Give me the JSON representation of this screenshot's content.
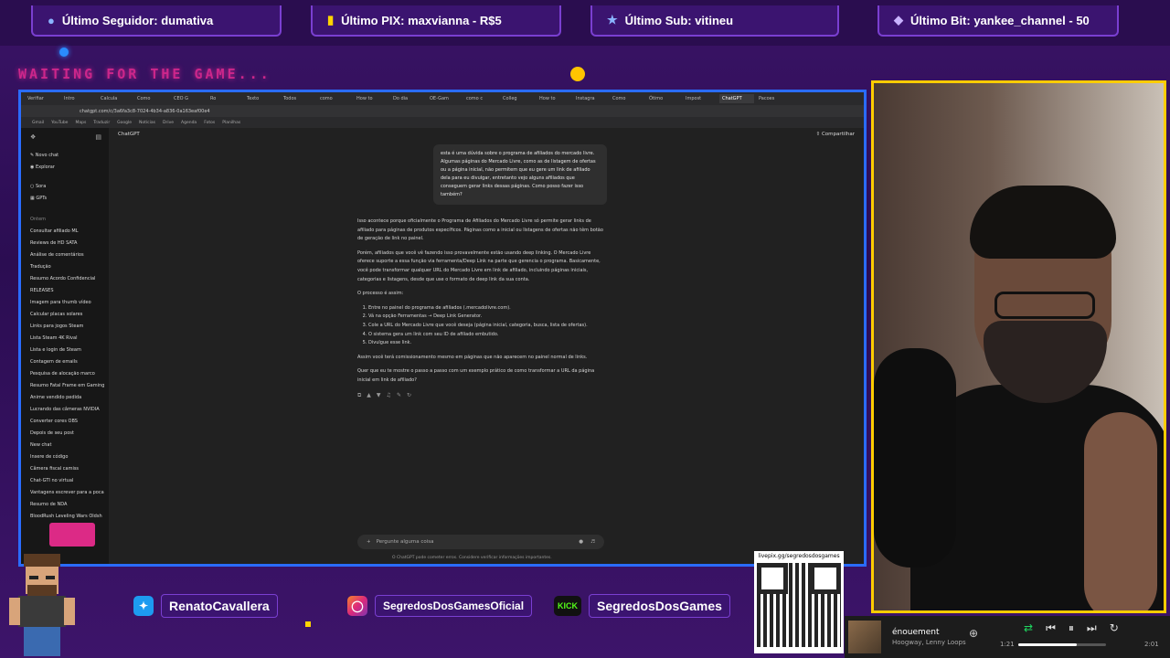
{
  "overlay": {
    "top_boxes": [
      {
        "icon": "user-icon",
        "label": "Último Seguidor: dumativa"
      },
      {
        "icon": "pix-icon",
        "label": "Último PIX: maxvianna - R$5"
      },
      {
        "icon": "star-icon",
        "label": "Último Sub: vitineu"
      },
      {
        "icon": "bits-icon",
        "label": "Último Bit: yankee_channel - 50"
      }
    ],
    "waiting_text": "WAITING FOR THE GAME...",
    "socials": [
      {
        "icon": "twitter-icon",
        "label": "RenatoCavallera"
      },
      {
        "icon": "instagram-icon",
        "label": "SegredosDosGamesOficial"
      },
      {
        "icon": "kick-icon",
        "badge": "KICK",
        "label": "SegredosDosGames"
      }
    ],
    "qr_label": "livepix.gg/segredosdosgames",
    "colors": {
      "accent": "#7a3fd1",
      "cam_border": "#ffcc00",
      "browser_border": "#2a6cff",
      "neon_pink": "#ff2e9a"
    }
  },
  "browser": {
    "tabs": [
      "Verifiar",
      "Intro",
      "Calcula",
      "Como",
      "CEO G",
      "Ro",
      "Texto",
      "Todos",
      "como",
      "How to",
      "Do dia",
      "OE-Gam",
      "como c",
      "Colleg",
      "How to",
      "Instagra",
      "Como",
      "Ótimo",
      "Impost",
      "ChatGPT",
      "Pacoes"
    ],
    "active_tab_index": 19,
    "url": "chatgpt.com/c/3a6fa3c8-7024-4b34-a836-0a163eaf00e4",
    "bookmarks": [
      "Gmail",
      "YouTube",
      "Maps",
      "Traduzir",
      "Google",
      "Notícias",
      "Drive",
      "Agenda",
      "Fotos",
      "Planilhas"
    ]
  },
  "chatgpt": {
    "sidebar": {
      "new_chat": "Novo chat",
      "explore": "Explorar",
      "sora": "Sora",
      "gpts": "GPTs",
      "section_today": "Ontem",
      "items": [
        "Consultar afiliado ML",
        "Reviews de HD SATA",
        "Análise de comentários",
        "Tradução",
        "Resumo Acordo Confidencial",
        "RELEASES",
        "Imagem para thumb vídeo",
        "Calcular placas solares",
        "Links para jogos Steam",
        "Lista Steam 4K Rival",
        "Lista e login de Steam",
        "Contagem de emails",
        "Pesquisa de alocação marco",
        "Resumo Fatal Frame em Gaming",
        "Anime vendido pedida",
        "Lucrando das câmeras NVIDIA",
        "Converter cores OBS",
        "Depois de seu post",
        "New chat",
        "Insere de código",
        "Câmera fiscal camiss",
        "Chat-GTI no virtual",
        "Vantagens escrever para a poca",
        "Resumo de NDA",
        "BloodRush Leveling Wars Oldsh"
      ]
    },
    "model_label": "ChatGPT",
    "share_label": "Compartilhar",
    "user_message": "esta é uma dúvida sobre o programa de afiliados do mercado livre. Algumas páginas do Mercado Livre, como as de listagem de ofertas ou a página inicial, não permitem que eu gere um link de afiliado dela para eu divulgar, entretanto vejo alguns afiliados que conseguem gerar links dessas páginas. Como posso fazer isso também?",
    "answer": {
      "p1": "Isso acontece porque oficialmente o Programa de Afiliados do Mercado Livre só permite gerar links de afiliado para páginas de produtos específicos. Páginas como a inicial ou listagens de ofertas não têm botão de geração de link no painel.",
      "p2": "Porém, afiliados que você vê fazendo isso provavelmente estão usando deep linking. O Mercado Livre oferece suporte a essa função via ferramenta/Deep Link na parte que gerencia o programa. Basicamente, você pode transformar qualquer URL do Mercado Livre em link de afiliado, incluindo páginas iniciais, categorias e listagens, desde que use o formato de deep link da sua conta.",
      "p3": "O processo é assim:",
      "steps": [
        "Entre no painel do programa de afiliados (.mercadolivre.com).",
        "Vá na opção Ferramentas → Deep Link Generator.",
        "Cole a URL do Mercado Livre que você deseja (página inicial, categoria, busca, lista de ofertas).",
        "O sistema gera um link com seu ID de afiliado embutido.",
        "Divulgue esse link."
      ],
      "p4": "Assim você terá comissionamento mesmo em páginas que não aparecem no painel normal de links.",
      "p5": "Quer que eu te mostre o passo a passo com um exemplo prático de como transformar a URL da página inicial em link de afiliado?"
    },
    "composer_placeholder": "Pergunte alguma coisa",
    "disclaimer": "O ChatGPT pode cometer erros. Considere verificar informações importantes."
  },
  "player": {
    "track": "énouement",
    "artists": "Hoogway, Lenny Loops",
    "time_current": "1:21",
    "time_total": "2:01",
    "progress": 0.67
  }
}
